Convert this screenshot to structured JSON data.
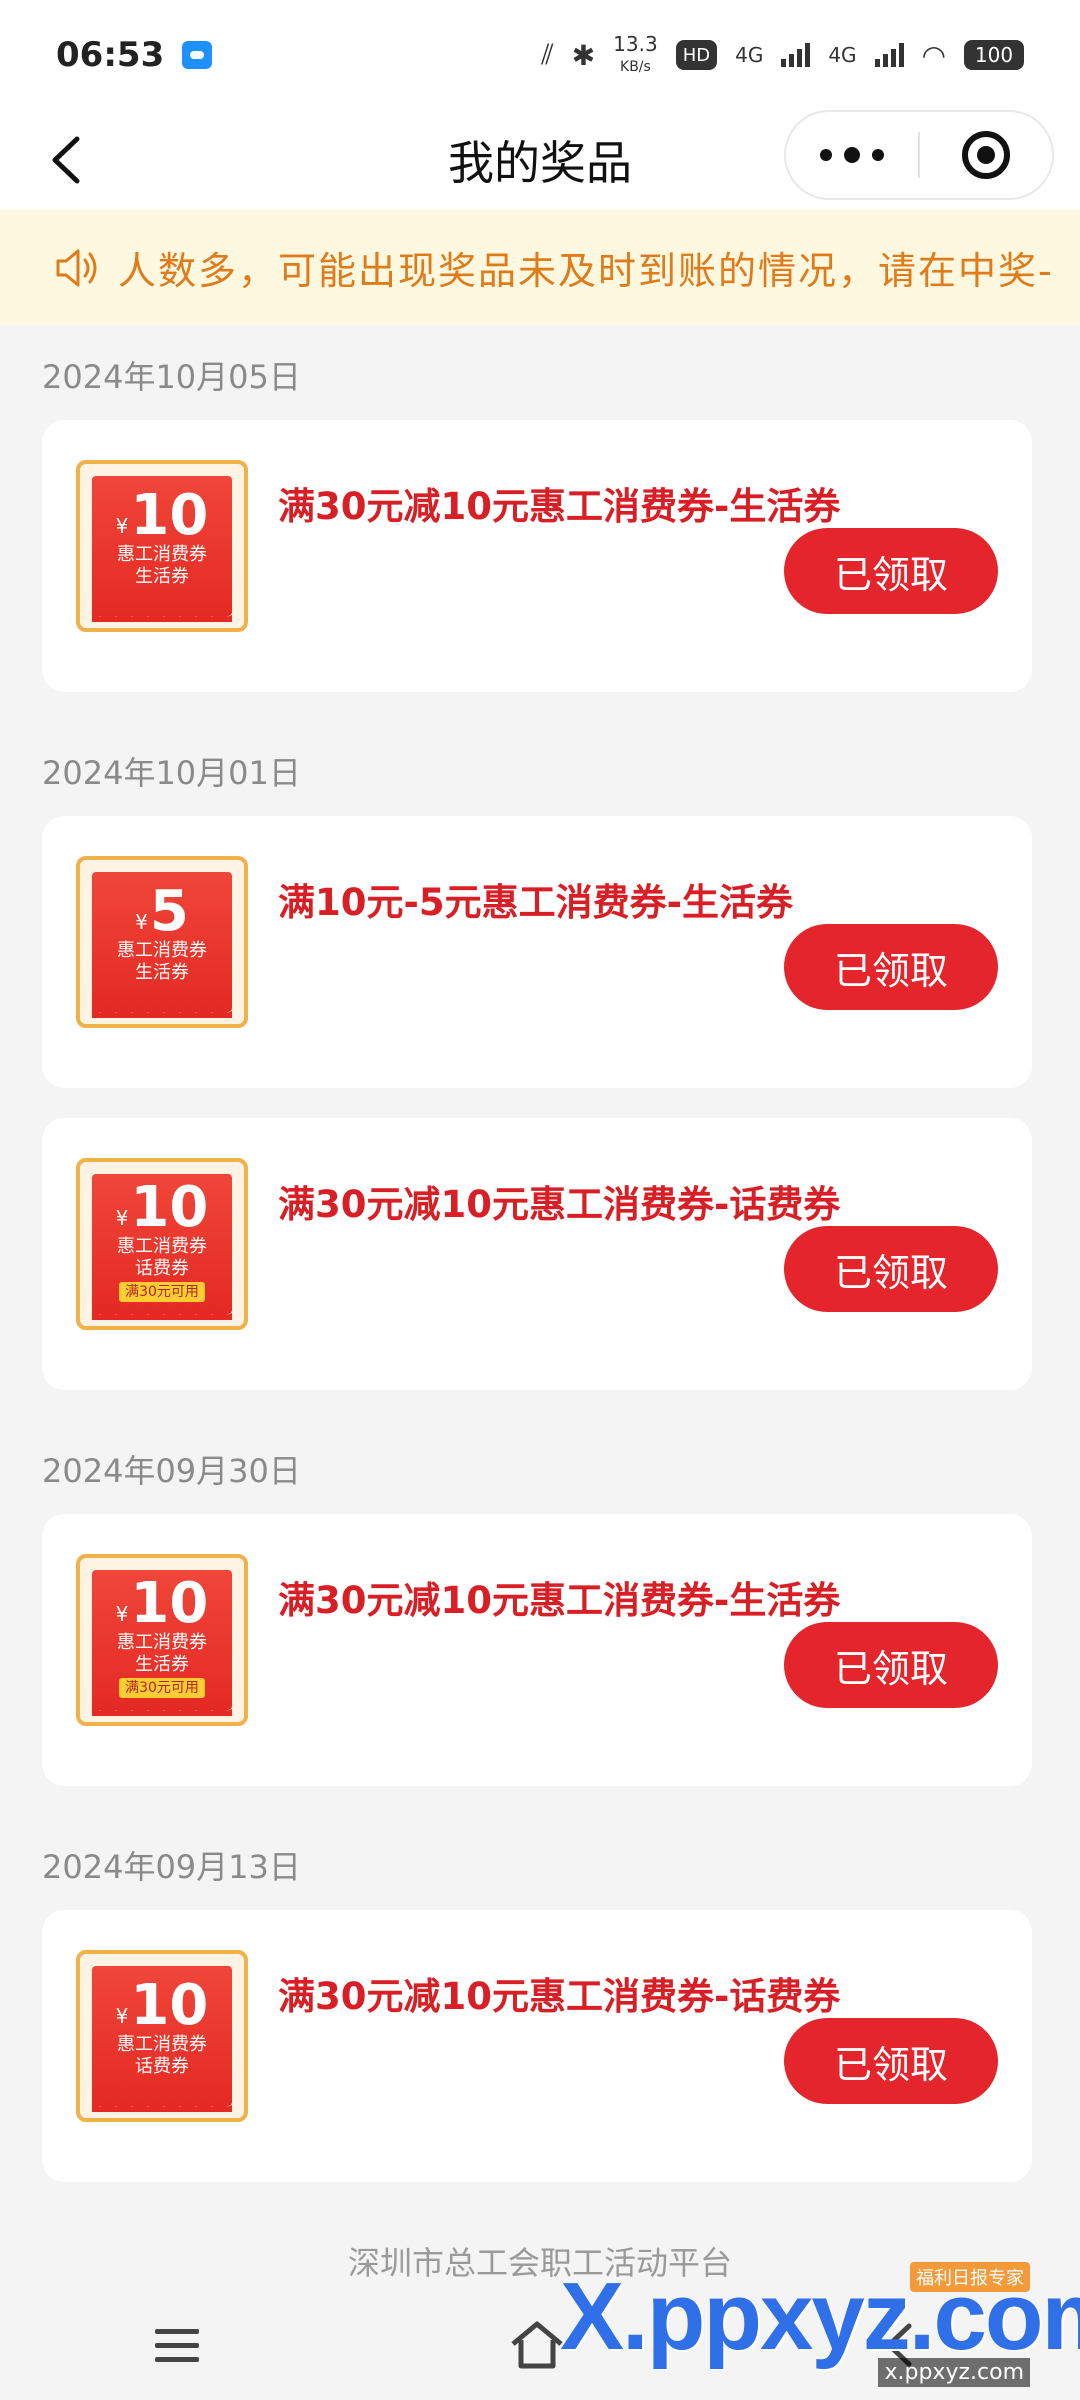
{
  "status_bar": {
    "time": "06:53",
    "net_speed": "13.3",
    "net_unit": "KB/s",
    "hd_label": "HD",
    "sig1": "4G",
    "sig2": "4G",
    "battery": "100"
  },
  "nav": {
    "title": "我的奖品"
  },
  "notice": {
    "text": "人数多，可能出现奖品未及时到账的情况，请在中奖-"
  },
  "groups": [
    {
      "date": "2024年10月05日",
      "items": [
        {
          "amount": "10",
          "line1": "惠工消费券",
          "line2": "生活券",
          "condition": "",
          "title": "满30元减10元惠工消费券-生活券",
          "button": "已领取"
        }
      ]
    },
    {
      "date": "2024年10月01日",
      "items": [
        {
          "amount": "5",
          "line1": "惠工消费券",
          "line2": "生活券",
          "condition": "",
          "title": "满10元-5元惠工消费券-生活券",
          "button": "已领取"
        },
        {
          "amount": "10",
          "line1": "惠工消费券",
          "line2": "话费券",
          "condition": "满30元可用",
          "title": "满30元减10元惠工消费券-话费券",
          "button": "已领取"
        }
      ]
    },
    {
      "date": "2024年09月30日",
      "items": [
        {
          "amount": "10",
          "line1": "惠工消费券",
          "line2": "生活券",
          "condition": "满30元可用",
          "title": "满30元减10元惠工消费券-生活券",
          "button": "已领取"
        }
      ]
    },
    {
      "date": "2024年09月13日",
      "items": [
        {
          "amount": "10",
          "line1": "惠工消费券",
          "line2": "话费券",
          "condition": "",
          "title": "满30元减10元惠工消费券-话费券",
          "button": "已领取"
        }
      ]
    }
  ],
  "footer": {
    "text": "深圳市总工会职工活动平台"
  },
  "watermark": {
    "brand": "X.ppxyz.com",
    "sub": "x.ppxyz.com",
    "badge": "福利日报专家"
  },
  "colors": {
    "accent_red": "#e4252b",
    "title_red": "#d91f26",
    "notice_bg": "#fff8e1",
    "notice_text": "#e07b1a"
  },
  "icons": [
    "back-arrow-icon",
    "more-dots-icon",
    "target-circle-icon",
    "speaker-icon",
    "menu-icon",
    "home-icon",
    "back-nav-icon"
  ]
}
